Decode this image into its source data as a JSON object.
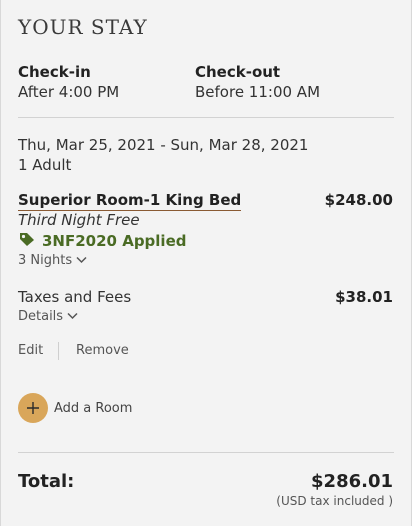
{
  "summary": {
    "heading": "YOUR STAY",
    "checkin_label": "Check-in",
    "checkin_value": "After 4:00 PM",
    "checkout_label": "Check-out",
    "checkout_value": "Before 11:00 AM",
    "dates": "Thu, Mar 25, 2021 - Sun, Mar 28, 2021",
    "guests": "1 Adult"
  },
  "room": {
    "name": "Superior Room-1 King Bed",
    "price": "$248.00",
    "promo_name": "Third Night Free",
    "promo_code": "3NF2020 Applied",
    "nights_label": "3 Nights"
  },
  "taxes": {
    "label": "Taxes and Fees",
    "amount": "$38.01",
    "details_label": "Details"
  },
  "actions": {
    "edit_label": "Edit",
    "remove_label": "Remove",
    "add_room_label": "Add a Room"
  },
  "total": {
    "label": "Total:",
    "value": "$286.01",
    "tax_note": "(USD tax included )"
  },
  "colors": {
    "accent_gold": "#d9a65a",
    "promo_green": "#4a6b24",
    "underline_brown": "#8a5a33"
  },
  "icons": {
    "tag": "tag-icon",
    "chevron": "chevron-down-icon",
    "plus": "plus-icon"
  }
}
